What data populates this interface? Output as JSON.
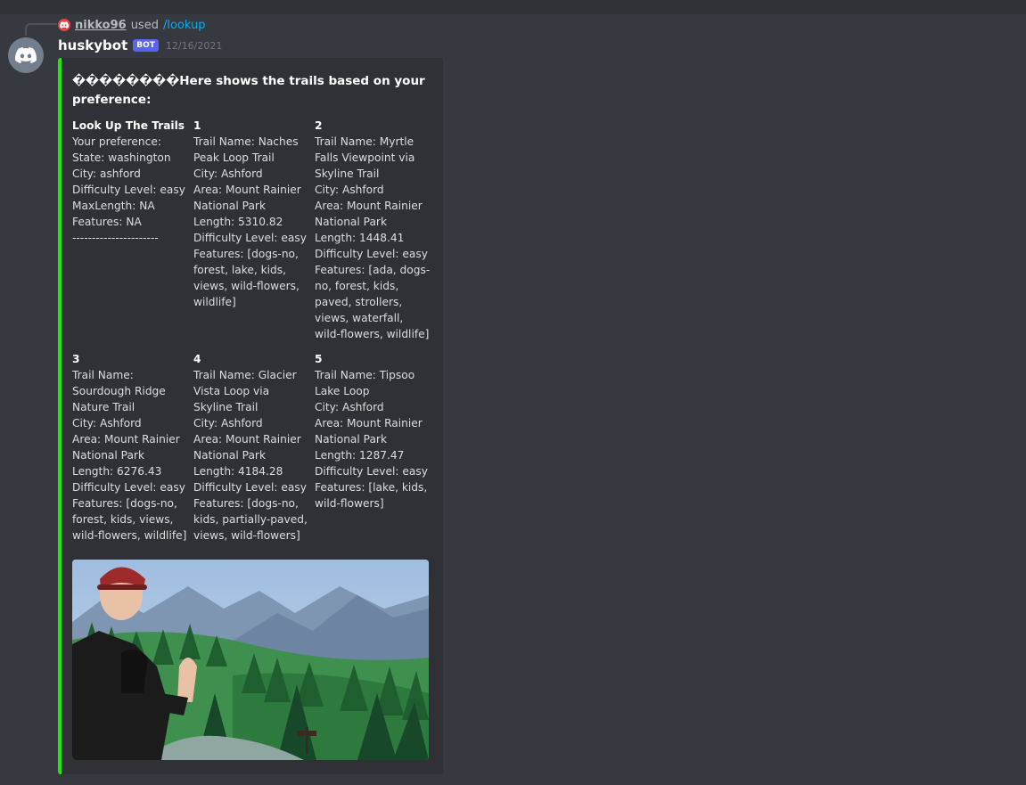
{
  "reply": {
    "username": "nikko96",
    "used_text": "used",
    "command": "/lookup"
  },
  "message": {
    "author": "huskybot",
    "bot_tag": "BOT",
    "timestamp": "12/16/2021",
    "embed": {
      "accent_color": "#1fea00",
      "title": "��������Here shows the trails based on your preference:",
      "fields": [
        {
          "name": "Look Up The Trails",
          "value": "Your preference:\nState: washington\nCity: ashford\nDifficulty Level: easy\nMaxLength: NA\nFeatures: NA\n----------------------"
        },
        {
          "name": "1",
          "value": "Trail Name: Naches Peak Loop Trail\nCity: Ashford\nArea: Mount Rainier National Park\nLength: 5310.82\nDifficulty Level: easy\nFeatures: [dogs-no, forest, lake, kids, views, wild-flowers, wildlife]"
        },
        {
          "name": "2",
          "value": "Trail Name: Myrtle Falls Viewpoint via Skyline Trail\nCity: Ashford\nArea: Mount Rainier National Park\nLength: 1448.41\nDifficulty Level: easy\nFeatures: [ada, dogs-no, forest, kids, paved, strollers, views, waterfall, wild-flowers, wildlife]"
        },
        {
          "name": "3",
          "value": "Trail Name: Sourdough Ridge Nature Trail\nCity: Ashford\nArea: Mount Rainier National Park\nLength: 6276.43\nDifficulty Level: easy\nFeatures: [dogs-no, forest, kids, views, wild-flowers, wildlife]"
        },
        {
          "name": "4",
          "value": "Trail Name: Glacier Vista Loop via Skyline Trail\nCity: Ashford\nArea: Mount Rainier National Park\nLength: 4184.28\nDifficulty Level: easy\nFeatures: [dogs-no, kids, partially-paved, views, wild-flowers]"
        },
        {
          "name": "5",
          "value": "Trail Name: Tipsoo Lake Loop\nCity: Ashford\nArea: Mount Rainier National Park\nLength: 1287.47\nDifficulty Level: easy\nFeatures: [lake, kids, wild-flowers]"
        }
      ]
    }
  }
}
